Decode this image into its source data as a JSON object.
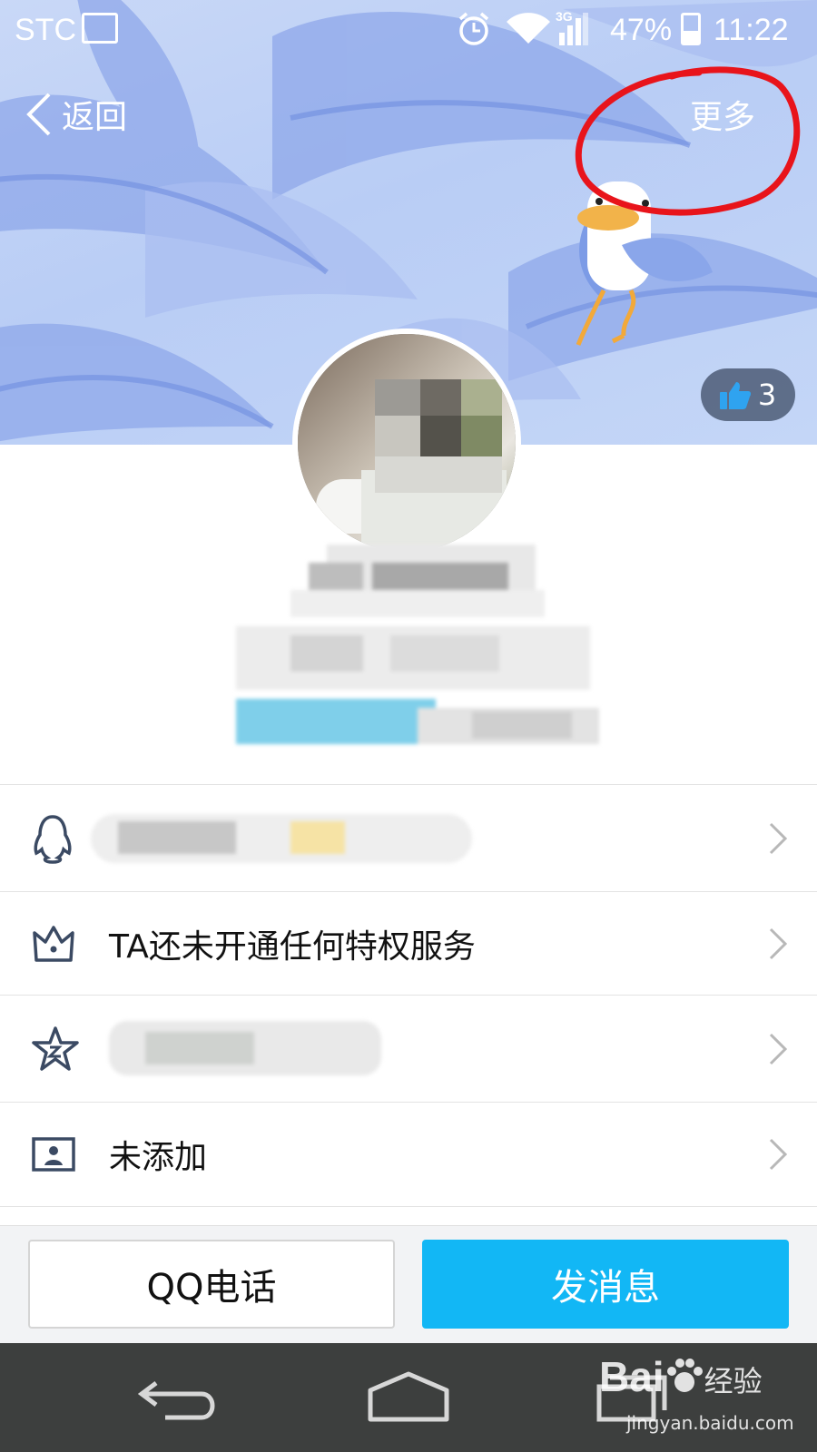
{
  "status_bar": {
    "carrier": "STC",
    "network": "3G",
    "battery": "47%",
    "time": "11:22"
  },
  "nav": {
    "back_label": "返回",
    "more_label": "更多"
  },
  "likes": {
    "count": "3"
  },
  "info_rows": {
    "privilege_text": "TA还未开通任何特权服务",
    "card_text": "未添加"
  },
  "actions": {
    "call_label": "QQ电话",
    "message_label": "发消息"
  },
  "watermark": {
    "brand": "Bai",
    "brand_cn": "经验",
    "url": "jingyan.baidu.com"
  },
  "colors": {
    "primary_button": "#12b7f5",
    "annotation_circle": "#e8141b",
    "cover_bg": "#bfd2f6",
    "system_nav": "#3d3f3e"
  },
  "icons": {
    "back": "chevron-left-icon",
    "like": "thumbs-up-icon",
    "qq": "penguin-icon",
    "privilege": "crown-icon",
    "level": "star-icon",
    "card": "id-card-icon",
    "row_arrow": "chevron-right-icon"
  }
}
